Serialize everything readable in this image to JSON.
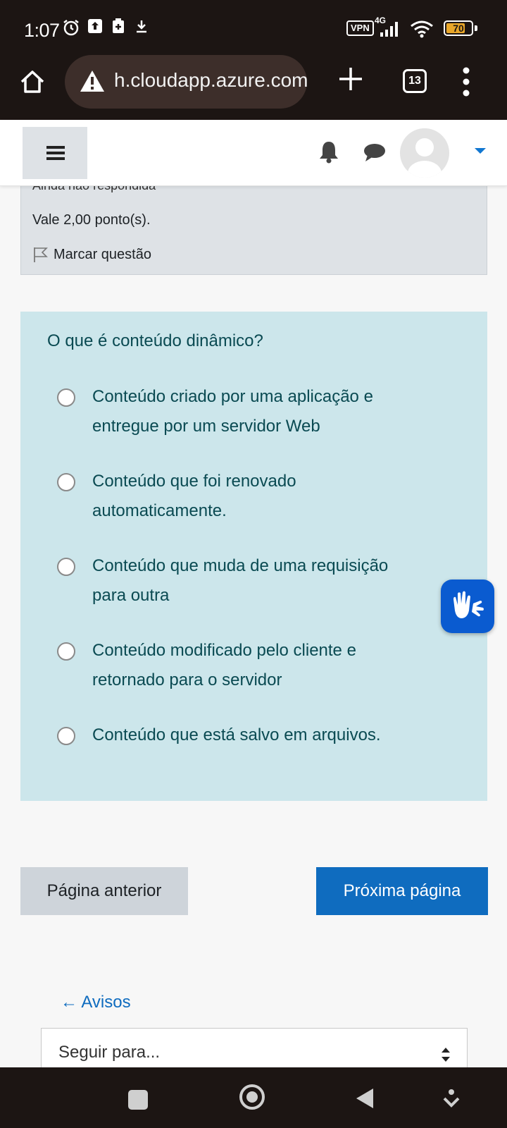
{
  "status_bar": {
    "time": "1:07",
    "vpn_label": "VPN",
    "network_label": "4G",
    "battery_level": "70"
  },
  "browser": {
    "url": "h.cloudapp.azure.com",
    "tab_count": "13"
  },
  "question_info": {
    "partial_status": "Ainda não respondida",
    "points": "Vale 2,00 ponto(s).",
    "flag_label": "Marcar questão"
  },
  "question": {
    "text": "O que é conteúdo dinâmico?",
    "answers": [
      {
        "line1": "Conteúdo criado por uma aplicação e",
        "line2": "entregue por um servidor Web"
      },
      {
        "line1": "Conteúdo que foi renovado",
        "line2": "automaticamente."
      },
      {
        "line1": "Conteúdo que muda de uma requisição",
        "line2": "para outra"
      },
      {
        "line1": "Conteúdo modificado pelo cliente e",
        "line2": "retornado para o servidor"
      },
      {
        "line1": "Conteúdo que está salvo em arquivos.",
        "line2": ""
      }
    ]
  },
  "navigation": {
    "prev_label": "Página anterior",
    "next_label": "Próxima página",
    "avisos_link": "← Avisos",
    "jump_placeholder": "Seguir para..."
  },
  "colors": {
    "primary": "#0f6cbf",
    "question_bg": "#cce6eb",
    "info_bg": "#dee2e6"
  }
}
